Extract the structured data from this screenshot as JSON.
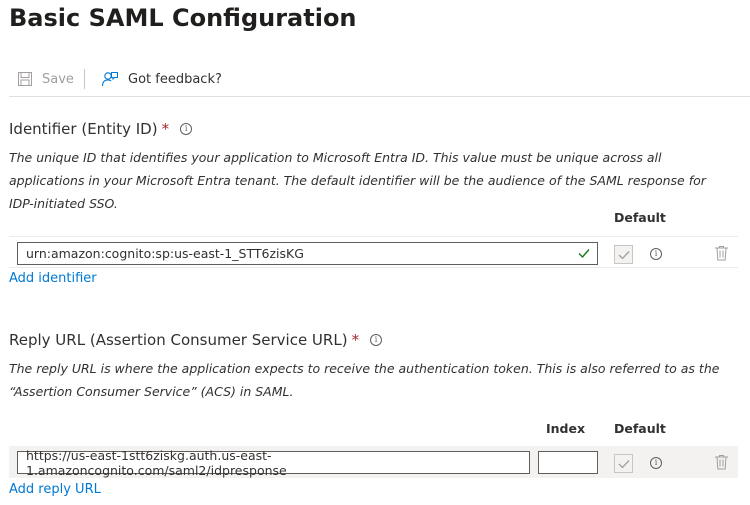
{
  "page": {
    "title": "Basic SAML Configuration"
  },
  "toolbar": {
    "save_label": "Save",
    "feedback_label": "Got feedback?"
  },
  "identifier": {
    "label": "Identifier (Entity ID)",
    "required_mark": "*",
    "description": "The unique ID that identifies your application to Microsoft Entra ID. This value must be unique across all applications in your Microsoft Entra tenant. The default identifier will be the audience of the SAML response for IDP-initiated SSO.",
    "default_header": "Default",
    "value": "urn:amazon:cognito:sp:us-east-1_STT6zisKG",
    "default_checked": true,
    "default_disabled": true,
    "add_link": "Add identifier"
  },
  "reply_url": {
    "label": "Reply URL (Assertion Consumer Service URL)",
    "required_mark": "*",
    "description": "The reply URL is where the application expects to receive the authentication token. This is also referred to as the “Assertion Consumer Service” (ACS) in SAML.",
    "index_header": "Index",
    "default_header": "Default",
    "value": "https://us-east-1stt6ziskg.auth.us-east-1.amazoncognito.com/saml2/idpresponse",
    "index_value": "",
    "default_checked": true,
    "default_disabled": true,
    "add_link": "Add reply URL"
  },
  "colors": {
    "accent": "#0078d4",
    "required": "#a4262c",
    "valid": "#107c10"
  },
  "info_glyph": "i"
}
